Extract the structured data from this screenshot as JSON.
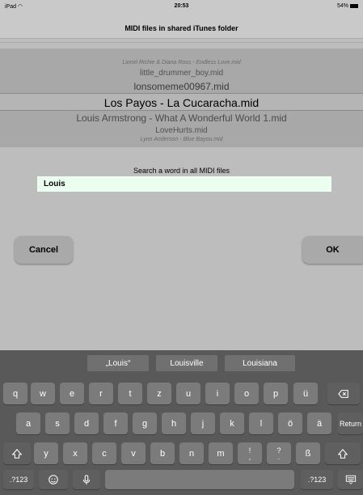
{
  "status_bar": {
    "device": "iPad",
    "wifi_icon": "wifi-icon",
    "time": "20:53",
    "battery": "54%"
  },
  "nav": {
    "title": "MIDI files in shared iTunes folder"
  },
  "picker": {
    "rows": [
      "Lionel Richie & Diana Ross - Endless Love.mid",
      "little_drummer_boy.mid",
      "lonsomeme00967.mid",
      "Los Payos - La Cucaracha.mid",
      "Louis Armstrong - What A Wonderful World 1.mid",
      "LoveHurts.mid",
      "Lynn Anderson - Blue Bayou.mid"
    ],
    "selected_index": 3
  },
  "search": {
    "label": "Search a word in all MIDI files",
    "value": "Louis"
  },
  "buttons": {
    "cancel": "Cancel",
    "ok": "OK"
  },
  "keyboard": {
    "suggestions": [
      "„Louis“",
      "Louisville",
      "Louisiana"
    ],
    "row1": [
      "q",
      "w",
      "e",
      "r",
      "t",
      "z",
      "u",
      "i",
      "o",
      "p",
      "ü"
    ],
    "row2": [
      "a",
      "s",
      "d",
      "f",
      "g",
      "h",
      "j",
      "k",
      "l",
      "ö",
      "ä"
    ],
    "return_label": "Return",
    "row3": [
      "y",
      "x",
      "c",
      "v",
      "b",
      "n",
      "m",
      "!\n,",
      "?\n.",
      "ß"
    ],
    "numbers_left": ".?123",
    "numbers_right": ".?123",
    "icons": {
      "backspace": "backspace-icon",
      "shift": "shift-icon",
      "emoji": "emoji-icon",
      "mic": "microphone-icon",
      "hide": "keyboard-hide-icon"
    }
  }
}
